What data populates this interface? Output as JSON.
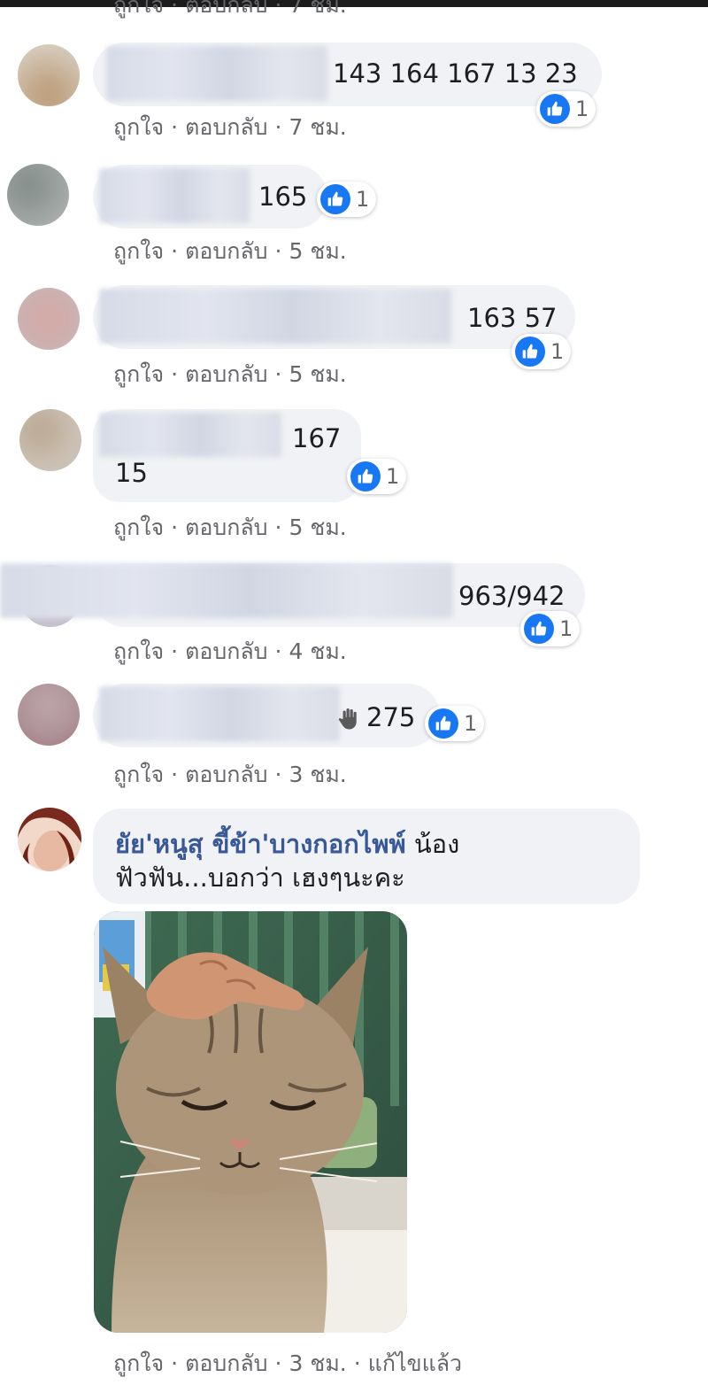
{
  "colors": {
    "like_blue": "#1877f2",
    "author_blue": "#385898",
    "meta_gray": "#65676b",
    "bubble_bg": "#f0f2f5"
  },
  "meta_labels": {
    "like": "ถูกใจ",
    "reply": "ตอบกลับ",
    "sep": "·"
  },
  "partial_top_meta": {
    "like": "ถูกใจ",
    "reply": "ตอบกลับ",
    "time": "7 ชม."
  },
  "comments": [
    {
      "text": "143 164 167 13 23",
      "reaction": {
        "icon": "like-icon",
        "count": "1"
      },
      "time": "7 ชม."
    },
    {
      "text": "165",
      "reaction": {
        "icon": "like-icon",
        "count": "1"
      },
      "time": "5 ชม."
    },
    {
      "text": "163 57",
      "reaction": {
        "icon": "like-icon",
        "count": "1"
      },
      "time": "5 ชม."
    },
    {
      "text_line1": "167",
      "text_line2": "15",
      "reaction": {
        "icon": "like-icon",
        "count": "1"
      },
      "time": "5 ชม."
    },
    {
      "text": "963/942",
      "reaction": {
        "icon": "like-icon",
        "count": "1"
      },
      "time": "4 ชม."
    },
    {
      "emoji": "raised-hand-icon",
      "text": "275",
      "reaction": {
        "icon": "like-icon",
        "count": "1"
      },
      "time": "3 ชม."
    }
  ],
  "last_comment": {
    "author": "ยัย'หนูสุ ขี้ข้า'บางกอกไพพ์",
    "text_line1_rest": "น้อง",
    "text_line2": "ฟัวฟัน...บอกว่า เฮงๆนะคะ",
    "time": "3 ชม.",
    "edited": "แก้ไขแล้ว",
    "photo_subject": "cat-photo"
  }
}
